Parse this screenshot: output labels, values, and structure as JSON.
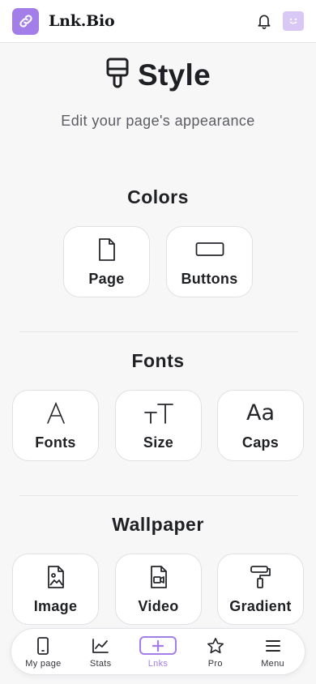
{
  "header": {
    "brand": "Lnk.Bio",
    "logo_color": "#a47ee8",
    "notification_icon": "bell-icon",
    "chat_icon": "chat-avatar-icon"
  },
  "page": {
    "title": "Style",
    "title_icon": "paint-brush-icon",
    "subtitle": "Edit your page's appearance"
  },
  "sections": {
    "colors": {
      "title": "Colors",
      "items": [
        {
          "label": "Page",
          "icon": "page-icon"
        },
        {
          "label": "Buttons",
          "icon": "button-outline-icon"
        }
      ]
    },
    "fonts": {
      "title": "Fonts",
      "items": [
        {
          "label": "Fonts",
          "icon": "font-a-icon",
          "glyph": "A"
        },
        {
          "label": "Size",
          "icon": "text-size-icon",
          "glyph": "ᴛT"
        },
        {
          "label": "Caps",
          "icon": "caps-icon",
          "glyph": "Aa"
        }
      ]
    },
    "wallpaper": {
      "title": "Wallpaper",
      "items": [
        {
          "label": "Image",
          "icon": "image-file-icon"
        },
        {
          "label": "Video",
          "icon": "video-file-icon"
        },
        {
          "label": "Gradient",
          "icon": "paint-roller-icon"
        }
      ]
    }
  },
  "bottom_nav": {
    "accent": "#a47ee8",
    "items": [
      {
        "label": "My page",
        "icon": "phone-icon"
      },
      {
        "label": "Stats",
        "icon": "chart-icon"
      },
      {
        "label": "Lnks",
        "icon": "plus-icon",
        "active": true
      },
      {
        "label": "Pro",
        "icon": "star-icon"
      },
      {
        "label": "Menu",
        "icon": "menu-icon"
      }
    ]
  }
}
